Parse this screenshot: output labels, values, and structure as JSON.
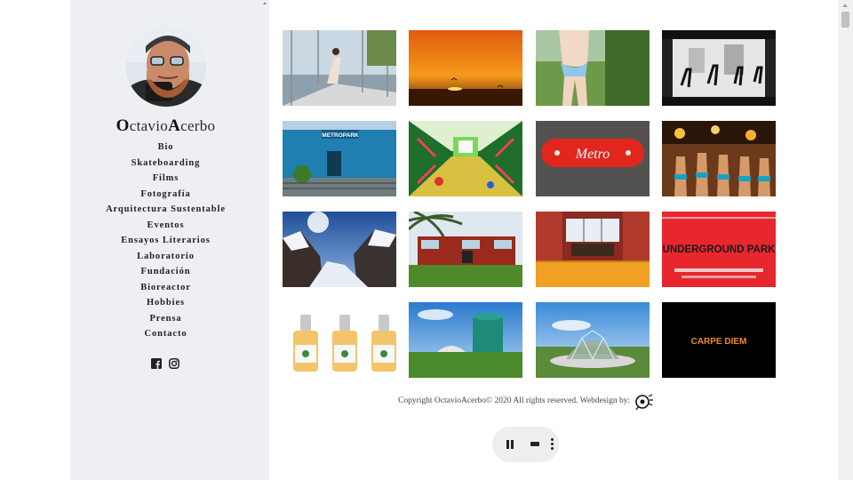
{
  "site": {
    "title_initial1": "O",
    "title_rest1": "ctavio",
    "title_initial2": "A",
    "title_rest2": "cerbo"
  },
  "nav": [
    "Bio",
    "Skateboarding",
    "Films",
    "Fotografía",
    "Arquitectura Sustentable",
    "Eventos",
    "Ensayos Literarios",
    "Laboratorio",
    "Fundación",
    "Bioreactor",
    "Hobbies",
    "Prensa",
    "Contacto"
  ],
  "social": [
    "facebook-icon",
    "instagram-icon"
  ],
  "gallery": [
    {
      "name": "skate-ramp-photo",
      "text": ""
    },
    {
      "name": "sunset-photo",
      "text": ""
    },
    {
      "name": "swimsuit-photo",
      "text": ""
    },
    {
      "name": "bw-skaters-photo",
      "text": ""
    },
    {
      "name": "metropark-building-photo",
      "text": "METROPARK"
    },
    {
      "name": "green-tunnel-photo",
      "text": ""
    },
    {
      "name": "red-skateboard-photo",
      "text": "Metro"
    },
    {
      "name": "party-photo",
      "text": ""
    },
    {
      "name": "snowy-mountains-photo",
      "text": ""
    },
    {
      "name": "container-house-photo",
      "text": ""
    },
    {
      "name": "container-interior-photo",
      "text": ""
    },
    {
      "name": "underground-park-poster",
      "text": "UNDERGROUND PARK"
    },
    {
      "name": "dropper-bottles-photo",
      "text": ""
    },
    {
      "name": "biodigester-tank-photo",
      "text": ""
    },
    {
      "name": "geodesic-dome-photo",
      "text": ""
    },
    {
      "name": "carpe-diem-card",
      "text": "CARPE DIEM"
    }
  ],
  "footer": {
    "copyright": "Copyright OctavioAcerbo© 2020 All rights reserved. Webdesign by:"
  },
  "player": {
    "state": "playing"
  }
}
